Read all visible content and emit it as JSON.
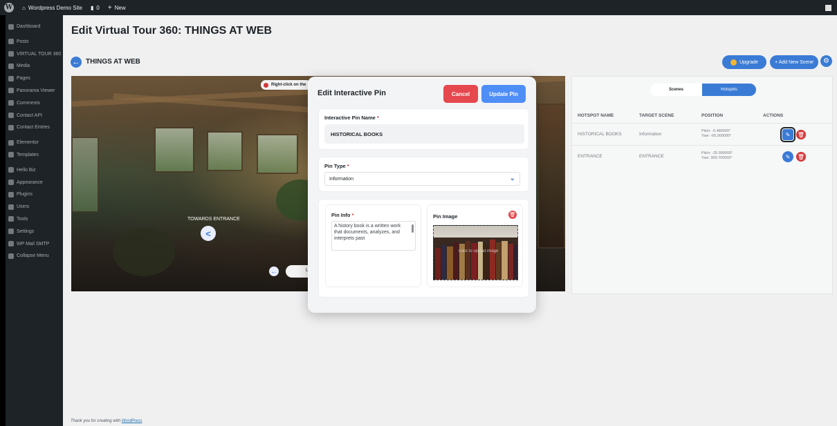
{
  "adminbar": {
    "site_name": "Wordpress Demo Site",
    "comments_count": "0",
    "new_label": "New"
  },
  "sidebar": {
    "items": [
      {
        "label": "Dashboard",
        "icon": "dashboard-icon"
      },
      {
        "label": "Posts",
        "icon": "pin-icon"
      },
      {
        "label": "VIRTUAL TOUR 360",
        "icon": "panorama-icon"
      },
      {
        "label": "Media",
        "icon": "media-icon"
      },
      {
        "label": "Pages",
        "icon": "page-icon"
      },
      {
        "label": "Panorama Viewer",
        "icon": "panorama-icon"
      },
      {
        "label": "Comments",
        "icon": "comment-icon"
      },
      {
        "label": "Contact API",
        "icon": "chart-icon"
      },
      {
        "label": "Contact Entries",
        "icon": "mail-icon"
      },
      {
        "label": "Elementor",
        "icon": "elementor-icon"
      },
      {
        "label": "Templates",
        "icon": "folder-icon"
      },
      {
        "label": "Hello Biz",
        "icon": "circle-icon"
      },
      {
        "label": "Appearance",
        "icon": "brush-icon"
      },
      {
        "label": "Plugins",
        "icon": "plug-icon"
      },
      {
        "label": "Users",
        "icon": "user-icon"
      },
      {
        "label": "Tools",
        "icon": "wrench-icon"
      },
      {
        "label": "Settings",
        "icon": "settings-icon"
      },
      {
        "label": "WP Mail SMTP",
        "icon": "mail-icon"
      },
      {
        "label": "Collapse Menu",
        "icon": "collapse-icon"
      }
    ]
  },
  "main": {
    "page_title": "Edit Virtual Tour 360: THINGS AT WEB",
    "scene_title": "THINGS AT WEB",
    "upgrade_label": "Upgrade",
    "add_scene_label": "+ Add New Scene",
    "footer_prefix": "Thank you for creating with ",
    "footer_link": "WordPress"
  },
  "viewer": {
    "right_click_hint": "Right-click on the",
    "hotspot_label": "TOWARDS ENTRANCE",
    "nav_pill_text": "L"
  },
  "hotspots": {
    "tab_scenes": "Scenes",
    "tab_hotspots": "Hotspots",
    "headers": {
      "name": "HOTSPOT NAME",
      "target": "TARGET SCENE",
      "position": "POSITION",
      "actions": "ACTIONS"
    },
    "rows": [
      {
        "name": "HISTORICAL BOOKS",
        "target": "Information",
        "pitch": "Pitch: -0.480000°",
        "yaw": "Yaw: -66.000000°"
      },
      {
        "name": "ENTRANCE",
        "target": "ENTRANCE",
        "pitch": "Pitch: -25.990000°",
        "yaw": "Yaw: 309.700000°"
      }
    ]
  },
  "modal": {
    "title": "Edit Interactive Pin",
    "cancel_label": "Cancel",
    "update_label": "Update Pin",
    "name_label": "Interactive Pin Name",
    "name_value": "HISTORICAL BOOKS",
    "type_label": "Pin Type",
    "type_value": "Information",
    "info_label": "Pin Info",
    "info_text": "A history book is a written work that documents, analyzes, and interprets past",
    "image_label": "Pin Image",
    "image_overlay_text": "Click to upload image",
    "required_mark": "*"
  },
  "colors": {
    "accent": "#3a7bd5",
    "danger": "#e5484d",
    "admin_bar": "#1d2327"
  }
}
